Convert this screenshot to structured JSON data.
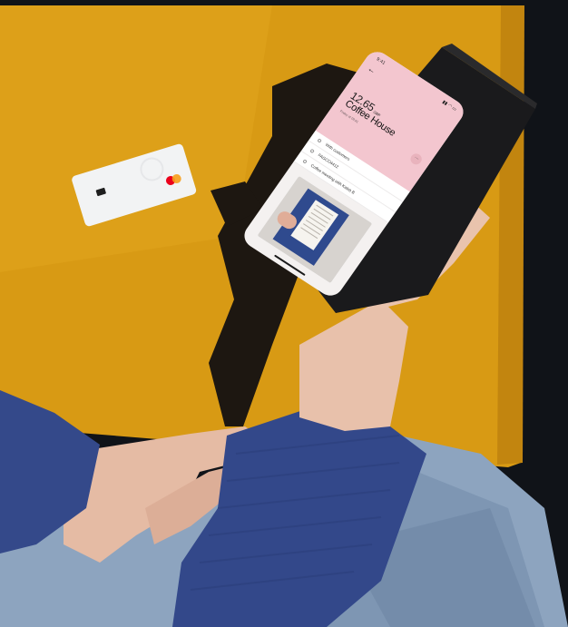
{
  "scene": {
    "colors": {
      "background": "#ffffff",
      "table_ochre": "#d99a12",
      "table_shadow": "#1b1713",
      "dark_floor": "#101318",
      "sleeve_blue": "#33488a",
      "jeans_blue": "#8aa2bd",
      "skin": "#e9c1ab",
      "phone_body": "#1a1a1c",
      "screen_pink": "#f3c6cf",
      "card_white": "#f2f3f4"
    },
    "objects": [
      "bank-card",
      "smartphone",
      "hand",
      "sleeve",
      "jeans",
      "shadow"
    ]
  },
  "card": {
    "logo": "mastercard-logo"
  },
  "phone": {
    "status": {
      "time": "9:41",
      "icons": "▮▮ ◠ ▭"
    },
    "header": {
      "back_icon": "←",
      "amount": "12.65",
      "currency": "GBP",
      "merchant": "Coffee House",
      "meta": "Friday at 09:41",
      "more_icon": "···"
    },
    "details": [
      {
        "icon": "split-icon",
        "label": "With customers"
      },
      {
        "icon": "receipt-icon",
        "label": "FAGCO4412"
      },
      {
        "icon": "note-icon",
        "label": "Coffee meeting with Kaleb B"
      }
    ],
    "attachment": {
      "description_icon": "receipt-photo"
    }
  }
}
